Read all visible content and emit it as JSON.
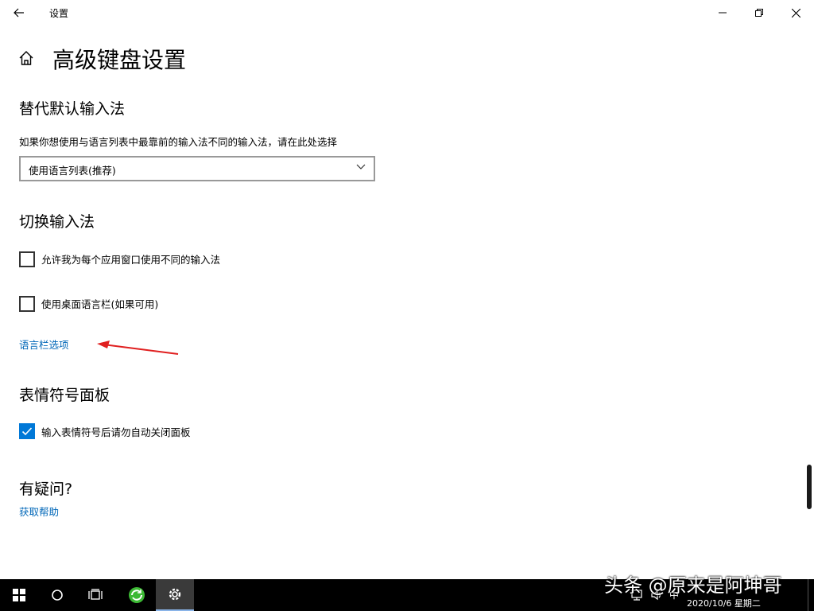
{
  "window": {
    "title": "设置"
  },
  "page": {
    "title": "高级键盘设置"
  },
  "sections": {
    "override": {
      "title": "替代默认输入法",
      "description": "如果你想使用与语言列表中最靠前的输入法不同的输入法，请在此处选择",
      "dropdown_value": "使用语言列表(推荐)"
    },
    "switching": {
      "title": "切换输入法",
      "checkbox_per_app": {
        "label": "允许我为每个应用窗口使用不同的输入法",
        "checked": false
      },
      "checkbox_langbar": {
        "label": "使用桌面语言栏(如果可用)",
        "checked": false
      },
      "langbar_link": "语言栏选项"
    },
    "emoji": {
      "title": "表情符号面板",
      "checkbox_autoclose": {
        "label": "输入表情符号后请勿自动关闭面板",
        "checked": true
      }
    },
    "help": {
      "title": "有疑问?",
      "link": "获取帮助"
    }
  },
  "annotation": {
    "arrow_color": "#e02020"
  },
  "taskbar": {
    "tray_ime": "中",
    "date": "2020/10/6 星期二"
  },
  "watermark": {
    "text": "头条 @原来是阿坤哥"
  },
  "colors": {
    "accent": "#0078d7",
    "link": "#0067b8",
    "taskbar": "#000000"
  }
}
